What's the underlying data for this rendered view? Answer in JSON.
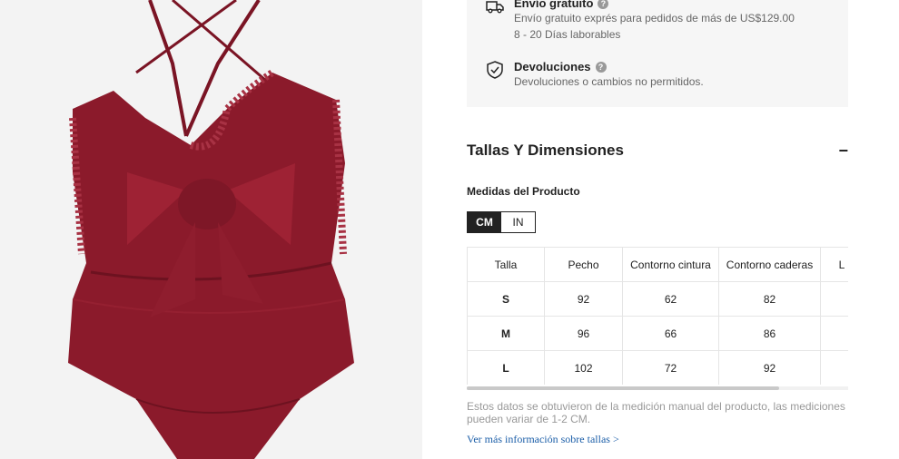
{
  "product_image": {
    "alt": "",
    "color": "#8b1a2b"
  },
  "shipping": {
    "free": {
      "title": "Envío gratuito",
      "line1": "Envío gratuito exprés para pedidos de más de US$129.00",
      "line2": "8 - 20 Días laborables",
      "icon": "truck-icon"
    },
    "returns": {
      "title": "Devoluciones",
      "line1": "Devoluciones o cambios no permitidos.",
      "icon": "shield-check-icon"
    },
    "help_glyph": "?"
  },
  "size_section": {
    "title": "Tallas Y Dimensiones",
    "collapse_glyph": "−",
    "measure_title": "Medidas del Producto",
    "units": [
      "CM",
      "IN"
    ],
    "active_unit": "CM",
    "table": {
      "headers": [
        "Talla",
        "Pecho",
        "Contorno cintura",
        "Contorno caderas",
        "L"
      ],
      "rows": [
        [
          "S",
          "92",
          "62",
          "82",
          ""
        ],
        [
          "M",
          "96",
          "66",
          "86",
          ""
        ],
        [
          "L",
          "102",
          "72",
          "92",
          ""
        ]
      ]
    },
    "scroll_progress": 0.82,
    "note": "Estos datos se obtuvieron de la medición manual del producto, las mediciones pueden variar de 1-2 CM.",
    "more_link": "Ver más información sobre tallas >"
  }
}
